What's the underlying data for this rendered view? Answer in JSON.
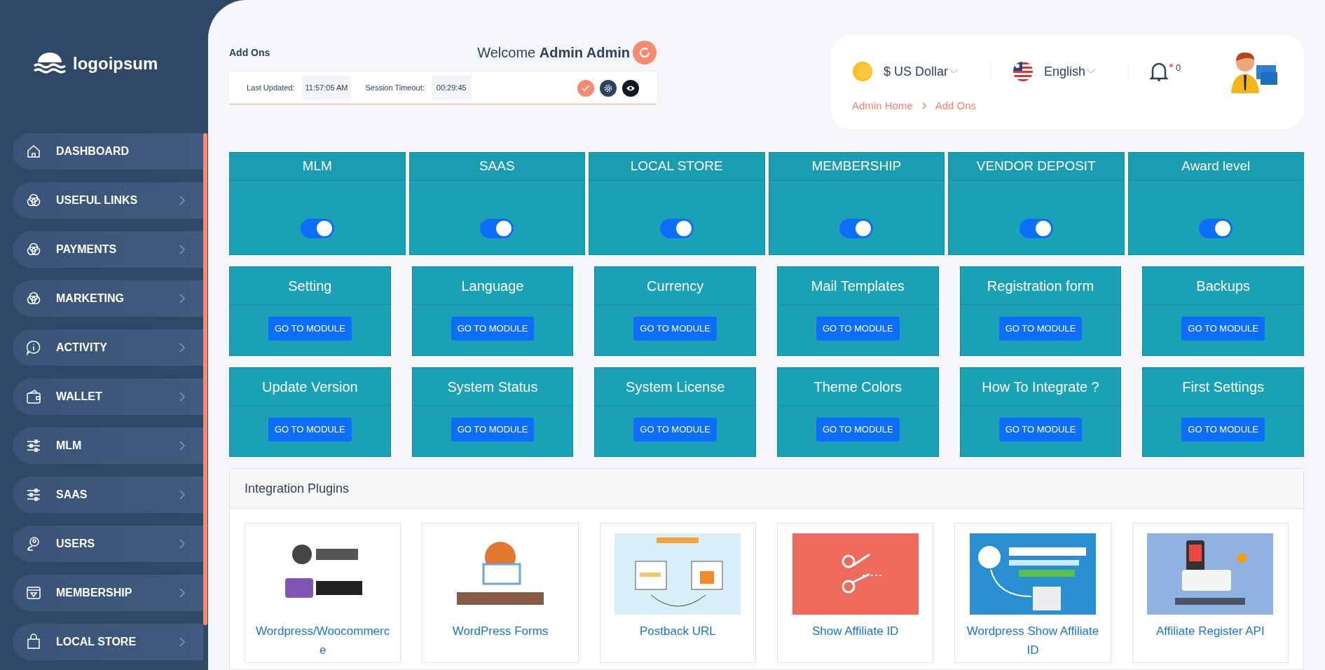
{
  "logo": {
    "text": "logoipsum"
  },
  "sidebar": {
    "items": [
      {
        "label": "DASHBOARD"
      },
      {
        "label": "USEFUL LINKS"
      },
      {
        "label": "PAYMENTS"
      },
      {
        "label": "MARKETING"
      },
      {
        "label": "ACTIVITY"
      },
      {
        "label": "WALLET"
      },
      {
        "label": "MLM"
      },
      {
        "label": "SAAS"
      },
      {
        "label": "USERS"
      },
      {
        "label": "MEMBERSHIP"
      },
      {
        "label": "LOCAL STORE"
      }
    ]
  },
  "page_title": "Add Ons",
  "welcome": "Welcome **Admin Admin**",
  "status_bar": {
    "last_updated_label": "Last Updated:",
    "last_updated": "11:57:05 AM",
    "session_label": "Session Timeout:",
    "session": "00:29:45"
  },
  "top_card": {
    "currency": "$ US Dollar",
    "language": "English",
    "notifications": "0",
    "breadcrumb": [
      "Admin Home",
      "Add Ons"
    ]
  },
  "addons": [
    {
      "title": "MLM",
      "on": true
    },
    {
      "title": "SAAS",
      "on": true
    },
    {
      "title": "LOCAL STORE",
      "on": true
    },
    {
      "title": "MEMBERSHIP",
      "on": true
    },
    {
      "title": "VENDOR DEPOSIT",
      "on": true
    },
    {
      "title": "Award level",
      "on": true
    }
  ],
  "modules": [
    {
      "title": "Setting",
      "button": "GO TO MODULE"
    },
    {
      "title": "Language",
      "button": "GO TO MODULE"
    },
    {
      "title": "Currency",
      "button": "GO TO MODULE"
    },
    {
      "title": "Mail Templates",
      "button": "GO TO MODULE"
    },
    {
      "title": "Registration form",
      "button": "GO TO MODULE"
    },
    {
      "title": "Backups",
      "button": "GO TO MODULE"
    },
    {
      "title": "Update Version",
      "button": "GO TO MODULE"
    },
    {
      "title": "System Status",
      "button": "GO TO MODULE"
    },
    {
      "title": "System License",
      "button": "GO TO MODULE"
    },
    {
      "title": "Theme Colors",
      "button": "GO TO MODULE"
    },
    {
      "title": "How To Integrate ?",
      "button": "GO TO MODULE"
    },
    {
      "title": "First Settings",
      "button": "GO TO MODULE"
    }
  ],
  "plugins": {
    "title": "Integration Plugins",
    "items": [
      {
        "kind": "picture",
        "label": "Wordpress/Woocommerce"
      },
      {
        "kind": "picture",
        "label": "WordPress Forms"
      },
      {
        "kind": "picture",
        "label": "Postback URL"
      },
      {
        "kind": "picture",
        "label": "Show Affiliate ID"
      },
      {
        "kind": "picture",
        "label": "Wordpress Show Affiliate ID"
      },
      {
        "kind": "picture",
        "label": "Affiliate Register API"
      }
    ]
  }
}
